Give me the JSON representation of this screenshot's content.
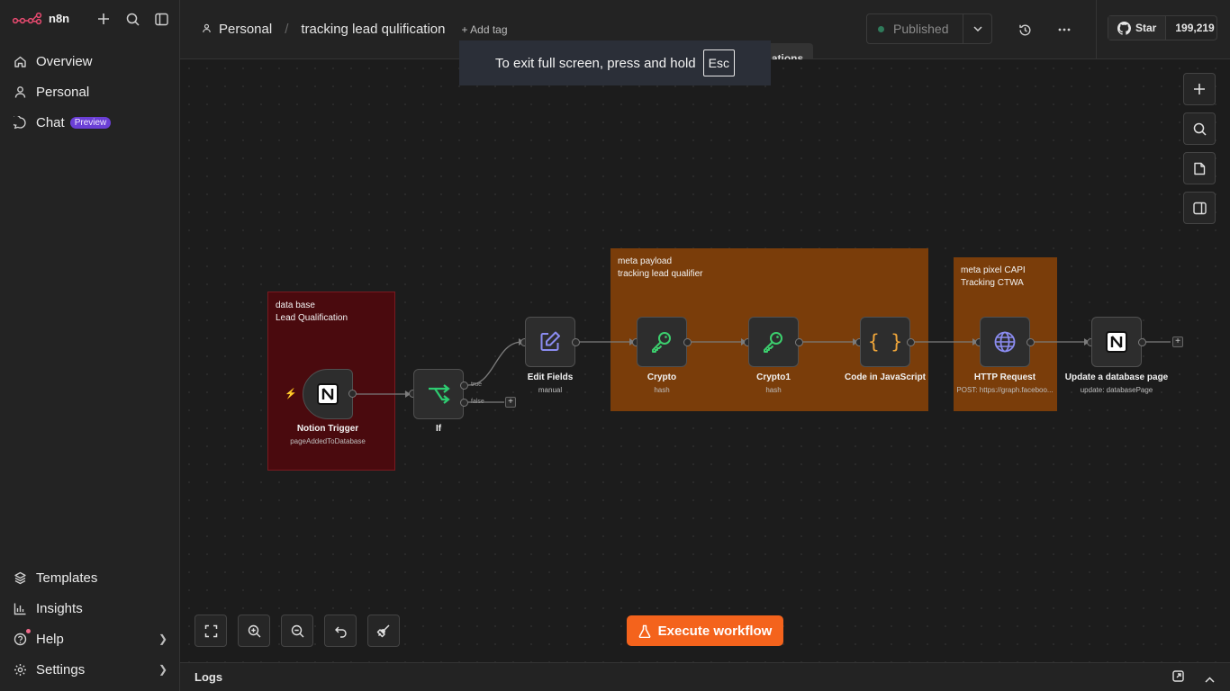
{
  "app": {
    "logo_text": "n8n"
  },
  "sidebar": {
    "items": [
      {
        "label": "Overview",
        "icon": "home-icon"
      },
      {
        "label": "Personal",
        "icon": "user-icon"
      },
      {
        "label": "Chat",
        "icon": "chat-icon",
        "badge": "Preview"
      }
    ],
    "bottom_items": [
      {
        "label": "Templates",
        "icon": "templates-icon"
      },
      {
        "label": "Insights",
        "icon": "insights-icon"
      },
      {
        "label": "Help",
        "icon": "help-icon"
      },
      {
        "label": "Settings",
        "icon": "gear-icon"
      }
    ]
  },
  "header": {
    "project": "Personal",
    "workflow_name": "tracking lead qulification",
    "add_tag": "+ Add tag",
    "status": "Published",
    "github_star_label": "Star",
    "github_star_count": "199,219"
  },
  "toast": {
    "text": "To exit full screen, press and hold",
    "key": "Esc",
    "behind_text": "ations"
  },
  "canvas": {
    "stickies": [
      {
        "line1": "data base",
        "line2": "Lead Qualification",
        "color": "#4a0a0e"
      },
      {
        "line1": "meta payload",
        "line2": "tracking lead qualifier",
        "color": "#7a3d0a"
      },
      {
        "line1": "meta pixel CAPI",
        "line2": "Tracking CTWA",
        "color": "#7a3d0a"
      }
    ],
    "nodes": [
      {
        "title": "Notion Trigger",
        "subtitle": "pageAddedToDatabase",
        "icon": "notion-icon"
      },
      {
        "title": "If",
        "subtitle": "",
        "icon": "if-branch-icon"
      },
      {
        "title": "Edit Fields",
        "subtitle": "manual",
        "icon": "pencil-icon"
      },
      {
        "title": "Crypto",
        "subtitle": "hash",
        "icon": "key-icon"
      },
      {
        "title": "Crypto1",
        "subtitle": "hash",
        "icon": "key-icon"
      },
      {
        "title": "Code in JavaScript",
        "subtitle": "",
        "icon": "code-braces-icon"
      },
      {
        "title": "HTTP Request",
        "subtitle": "POST: https://graph.faceboo...",
        "icon": "globe-icon"
      },
      {
        "title": "Update a database page",
        "subtitle": "update: databasePage",
        "icon": "notion-icon"
      }
    ],
    "branch_true": "true",
    "branch_false": "false"
  },
  "execute_label": "Execute workflow",
  "logs_label": "Logs",
  "colors": {
    "accent": "#f4631c",
    "sticky_red": "#4a0a0e",
    "sticky_orange": "#7a3d0a",
    "preview_badge": "#6b3fd6"
  }
}
